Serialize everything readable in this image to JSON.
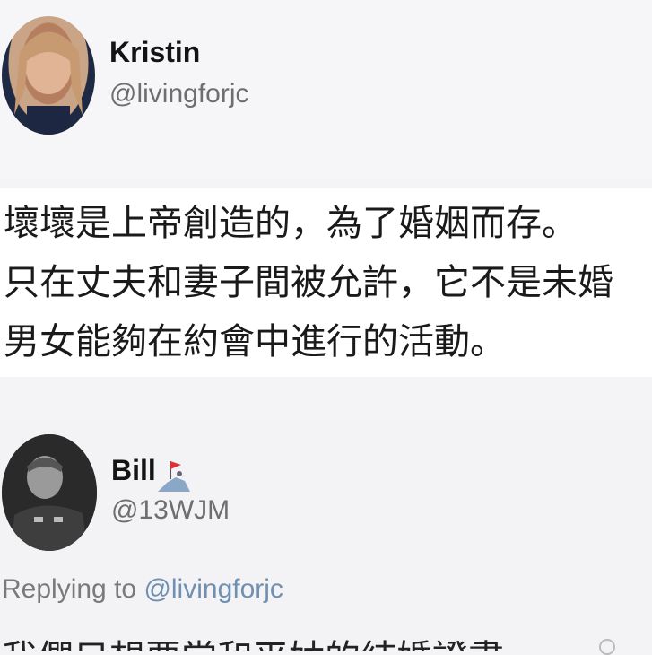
{
  "tweet": {
    "author_name": "Kristin",
    "author_handle": "@livingforjc",
    "lines": [
      "壞壞是上帝創造的，為了婚姻而存。",
      "只在丈夫和妻子間被允許，它不是未婚",
      "男女能夠在約會中進行的活動。"
    ]
  },
  "reply": {
    "author_name": "Bill",
    "author_handle": "@13WJM",
    "badge_icon": "flag-badge-icon",
    "replying_prefix": "Replying to ",
    "replying_mention": "@livingforjc",
    "partial_text": "我們只想要當和平姑的結婚證書"
  },
  "colors": {
    "handle": "#6e6e6e",
    "mention": "#6f8fb3",
    "background": "#f4f4f6"
  }
}
